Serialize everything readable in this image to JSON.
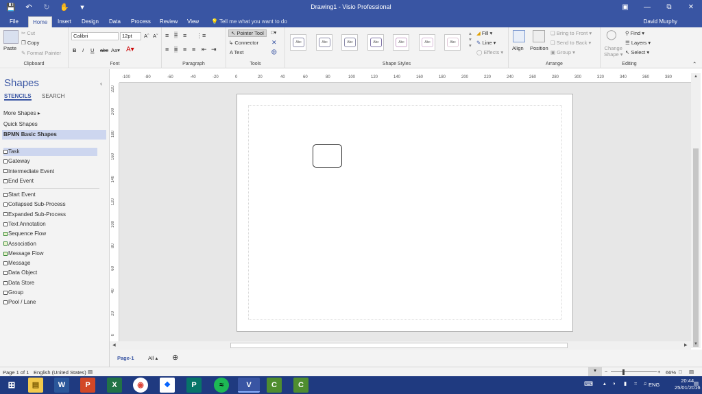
{
  "window": {
    "title": "Drawing1 - Visio Professional",
    "user": "David Murphy"
  },
  "menu": {
    "tabs": [
      "File",
      "Home",
      "Insert",
      "Design",
      "Data",
      "Process",
      "Review",
      "View"
    ],
    "tell_me": "Tell me what you want to do"
  },
  "ribbon": {
    "clipboard": {
      "paste": "Paste",
      "cut": "Cut",
      "copy": "Copy",
      "format_painter": "Format Painter",
      "label": "Clipboard"
    },
    "font": {
      "name": "Calibri",
      "size": "12pt",
      "label": "Font"
    },
    "paragraph": {
      "label": "Paragraph"
    },
    "tools": {
      "pointer": "Pointer Tool",
      "connector": "Connector",
      "text": "Text",
      "label": "Tools"
    },
    "shape_styles": {
      "sample": "Abc",
      "fill": "Fill",
      "line": "Line",
      "effects": "Effects",
      "label": "Shape Styles"
    },
    "arrange": {
      "align": "Align",
      "position": "Position",
      "bring_front": "Bring to Front",
      "send_back": "Send to Back",
      "group": "Group",
      "label": "Arrange"
    },
    "editing": {
      "change_shape_line1": "Change",
      "change_shape_line2": "Shape",
      "find": "Find",
      "layers": "Layers",
      "select": "Select",
      "label": "Editing"
    }
  },
  "shapes_pane": {
    "title": "Shapes",
    "tabs": [
      "STENCILS",
      "SEARCH"
    ],
    "more_shapes": "More Shapes",
    "quick_shapes": "Quick Shapes",
    "stencil": "BPMN Basic Shapes",
    "group1": [
      "Task",
      "Gateway",
      "Intermediate Event",
      "End Event"
    ],
    "group2": [
      "Start Event",
      "Collapsed Sub-Process",
      "Expanded Sub-Process",
      "Text Annotation",
      "Sequence Flow",
      "Association",
      "Message Flow",
      "Message",
      "Data Object",
      "Data Store",
      "Group",
      "Pool / Lane"
    ]
  },
  "rulers": {
    "horizontal": [
      "-100",
      "-80",
      "-60",
      "-40",
      "-20",
      "0",
      "20",
      "40",
      "60",
      "80",
      "100",
      "120",
      "140",
      "160",
      "180",
      "200",
      "220",
      "240",
      "260",
      "280",
      "300",
      "320",
      "340",
      "360",
      "380"
    ],
    "vertical": [
      "220",
      "200",
      "180",
      "160",
      "140",
      "120",
      "100",
      "80",
      "60",
      "40",
      "20",
      "0"
    ]
  },
  "page_tabs": {
    "current": "Page-1",
    "all": "All"
  },
  "status": {
    "page": "Page 1 of 1",
    "language": "English (United States)",
    "zoom": "66%"
  },
  "taskbar": {
    "time": "20:44",
    "date": "25/01/2016",
    "lang": "ENG"
  },
  "colors": {
    "accent": "#3955a3",
    "taskbar": "#1f3a80"
  }
}
